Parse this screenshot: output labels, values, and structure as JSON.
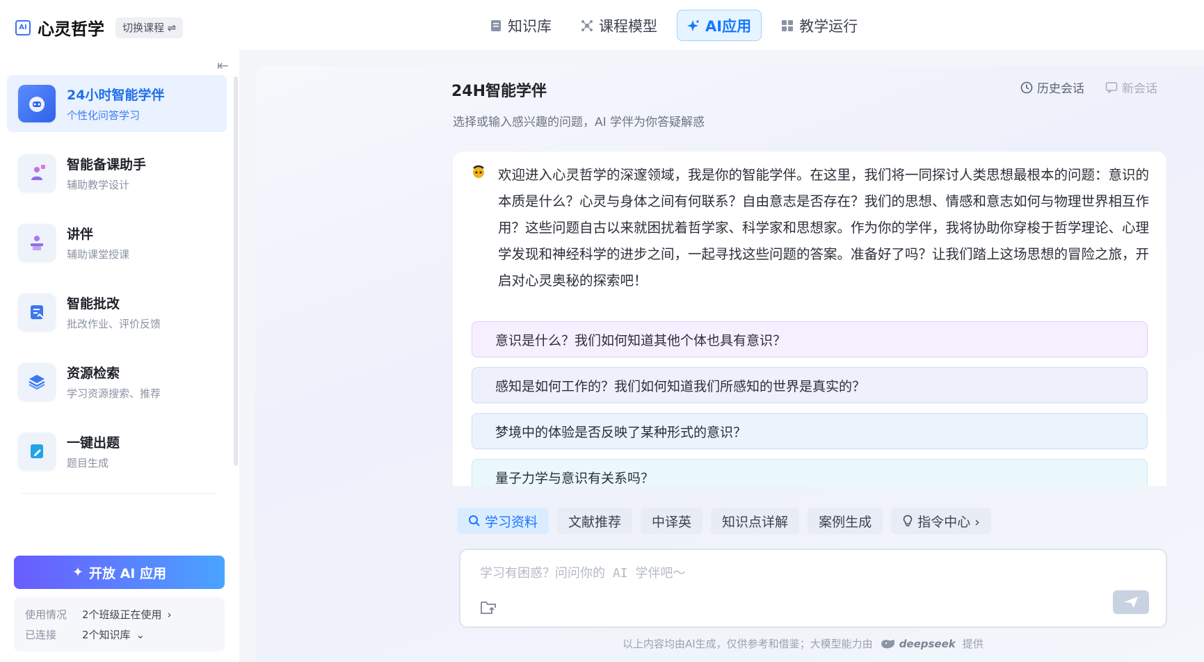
{
  "header": {
    "logo_text": "AI",
    "title": "心灵哲学",
    "switch_label": "切换课程 ⇌",
    "nav": [
      {
        "label": "知识库",
        "icon": "book-icon",
        "active": false
      },
      {
        "label": "课程模型",
        "icon": "molecule-icon",
        "active": false
      },
      {
        "label": "AI应用",
        "icon": "sparkle-icon",
        "active": true
      },
      {
        "label": "教学运行",
        "icon": "grid-icon",
        "active": false
      }
    ]
  },
  "sidebar": {
    "items": [
      {
        "title": "24小时智能学伴",
        "sub": "个性化问答学习",
        "icon": "robot-icon",
        "active": true
      },
      {
        "title": "智能备课助手",
        "sub": "辅助教学设计",
        "icon": "teacher-icon",
        "active": false
      },
      {
        "title": "讲伴",
        "sub": "辅助课堂授课",
        "icon": "lecture-icon",
        "active": false
      },
      {
        "title": "智能批改",
        "sub": "批改作业、评价反馈",
        "icon": "grading-icon",
        "active": false
      },
      {
        "title": "资源检索",
        "sub": "学习资源搜索、推荐",
        "icon": "layers-icon",
        "active": false
      },
      {
        "title": "一键出题",
        "sub": "题目生成",
        "icon": "edit-doc-icon",
        "active": false
      }
    ],
    "open_button": "开放 AI 应用",
    "usage": {
      "label1": "使用情况",
      "value1": "2个班级正在使用",
      "label2": "已连接",
      "value2": "2个知识库"
    }
  },
  "main": {
    "title": "24H智能学伴",
    "subtitle": "选择或输入感兴趣的问题，AI 学伴为你答疑解惑",
    "history_label": "历史会话",
    "new_chat_label": "新会话",
    "welcome": "欢迎进入心灵哲学的深邃领域，我是你的智能学伴。在这里，我们将一同探讨人类思想最根本的问题：意识的本质是什么？心灵与身体之间有何联系？自由意志是否存在？我们的思想、情感和意志如何与物理世界相互作用？这些问题自古以来就困扰着哲学家、科学家和思想家。作为你的学伴，我将协助你穿梭于哲学理论、心理学发现和神经科学的进步之间，一起寻找这些问题的答案。准备好了吗？让我们踏上这场思想的冒险之旅，开启对心灵奥秘的探索吧！",
    "questions": [
      "意识是什么？我们如何知道其他个体也具有意识？",
      "感知是如何工作的？我们如何知道我们所感知的世界是真实的？",
      "梦境中的体验是否反映了某种形式的意识？",
      "量子力学与意识有关系吗？"
    ],
    "chips": [
      {
        "label": "学习资料",
        "icon": "search-icon",
        "active": true
      },
      {
        "label": "文献推荐",
        "active": false
      },
      {
        "label": "中译英",
        "active": false
      },
      {
        "label": "知识点详解",
        "active": false
      },
      {
        "label": "案例生成",
        "active": false
      },
      {
        "label": "指令中心 ›",
        "icon": "bulb-icon",
        "active": false
      }
    ],
    "input_placeholder": "学习有困惑？问问你的 AI 学伴吧～",
    "footer_text": "以上内容均由AI生成，仅供参考和借鉴；大模型能力由",
    "footer_brand": "deepseek",
    "footer_suffix": "提供"
  }
}
